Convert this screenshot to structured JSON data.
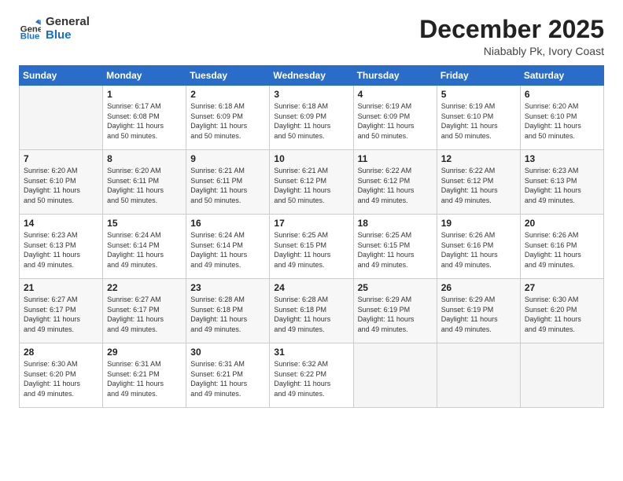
{
  "logo": {
    "general": "General",
    "blue": "Blue"
  },
  "title": "December 2025",
  "location": "Niabably Pk, Ivory Coast",
  "days_of_week": [
    "Sunday",
    "Monday",
    "Tuesday",
    "Wednesday",
    "Thursday",
    "Friday",
    "Saturday"
  ],
  "weeks": [
    [
      {
        "day": "",
        "info": ""
      },
      {
        "day": "1",
        "info": "Sunrise: 6:17 AM\nSunset: 6:08 PM\nDaylight: 11 hours\nand 50 minutes."
      },
      {
        "day": "2",
        "info": "Sunrise: 6:18 AM\nSunset: 6:09 PM\nDaylight: 11 hours\nand 50 minutes."
      },
      {
        "day": "3",
        "info": "Sunrise: 6:18 AM\nSunset: 6:09 PM\nDaylight: 11 hours\nand 50 minutes."
      },
      {
        "day": "4",
        "info": "Sunrise: 6:19 AM\nSunset: 6:09 PM\nDaylight: 11 hours\nand 50 minutes."
      },
      {
        "day": "5",
        "info": "Sunrise: 6:19 AM\nSunset: 6:10 PM\nDaylight: 11 hours\nand 50 minutes."
      },
      {
        "day": "6",
        "info": "Sunrise: 6:20 AM\nSunset: 6:10 PM\nDaylight: 11 hours\nand 50 minutes."
      }
    ],
    [
      {
        "day": "7",
        "info": "Sunrise: 6:20 AM\nSunset: 6:10 PM\nDaylight: 11 hours\nand 50 minutes."
      },
      {
        "day": "8",
        "info": "Sunrise: 6:20 AM\nSunset: 6:11 PM\nDaylight: 11 hours\nand 50 minutes."
      },
      {
        "day": "9",
        "info": "Sunrise: 6:21 AM\nSunset: 6:11 PM\nDaylight: 11 hours\nand 50 minutes."
      },
      {
        "day": "10",
        "info": "Sunrise: 6:21 AM\nSunset: 6:12 PM\nDaylight: 11 hours\nand 50 minutes."
      },
      {
        "day": "11",
        "info": "Sunrise: 6:22 AM\nSunset: 6:12 PM\nDaylight: 11 hours\nand 49 minutes."
      },
      {
        "day": "12",
        "info": "Sunrise: 6:22 AM\nSunset: 6:12 PM\nDaylight: 11 hours\nand 49 minutes."
      },
      {
        "day": "13",
        "info": "Sunrise: 6:23 AM\nSunset: 6:13 PM\nDaylight: 11 hours\nand 49 minutes."
      }
    ],
    [
      {
        "day": "14",
        "info": "Sunrise: 6:23 AM\nSunset: 6:13 PM\nDaylight: 11 hours\nand 49 minutes."
      },
      {
        "day": "15",
        "info": "Sunrise: 6:24 AM\nSunset: 6:14 PM\nDaylight: 11 hours\nand 49 minutes."
      },
      {
        "day": "16",
        "info": "Sunrise: 6:24 AM\nSunset: 6:14 PM\nDaylight: 11 hours\nand 49 minutes."
      },
      {
        "day": "17",
        "info": "Sunrise: 6:25 AM\nSunset: 6:15 PM\nDaylight: 11 hours\nand 49 minutes."
      },
      {
        "day": "18",
        "info": "Sunrise: 6:25 AM\nSunset: 6:15 PM\nDaylight: 11 hours\nand 49 minutes."
      },
      {
        "day": "19",
        "info": "Sunrise: 6:26 AM\nSunset: 6:16 PM\nDaylight: 11 hours\nand 49 minutes."
      },
      {
        "day": "20",
        "info": "Sunrise: 6:26 AM\nSunset: 6:16 PM\nDaylight: 11 hours\nand 49 minutes."
      }
    ],
    [
      {
        "day": "21",
        "info": "Sunrise: 6:27 AM\nSunset: 6:17 PM\nDaylight: 11 hours\nand 49 minutes."
      },
      {
        "day": "22",
        "info": "Sunrise: 6:27 AM\nSunset: 6:17 PM\nDaylight: 11 hours\nand 49 minutes."
      },
      {
        "day": "23",
        "info": "Sunrise: 6:28 AM\nSunset: 6:18 PM\nDaylight: 11 hours\nand 49 minutes."
      },
      {
        "day": "24",
        "info": "Sunrise: 6:28 AM\nSunset: 6:18 PM\nDaylight: 11 hours\nand 49 minutes."
      },
      {
        "day": "25",
        "info": "Sunrise: 6:29 AM\nSunset: 6:19 PM\nDaylight: 11 hours\nand 49 minutes."
      },
      {
        "day": "26",
        "info": "Sunrise: 6:29 AM\nSunset: 6:19 PM\nDaylight: 11 hours\nand 49 minutes."
      },
      {
        "day": "27",
        "info": "Sunrise: 6:30 AM\nSunset: 6:20 PM\nDaylight: 11 hours\nand 49 minutes."
      }
    ],
    [
      {
        "day": "28",
        "info": "Sunrise: 6:30 AM\nSunset: 6:20 PM\nDaylight: 11 hours\nand 49 minutes."
      },
      {
        "day": "29",
        "info": "Sunrise: 6:31 AM\nSunset: 6:21 PM\nDaylight: 11 hours\nand 49 minutes."
      },
      {
        "day": "30",
        "info": "Sunrise: 6:31 AM\nSunset: 6:21 PM\nDaylight: 11 hours\nand 49 minutes."
      },
      {
        "day": "31",
        "info": "Sunrise: 6:32 AM\nSunset: 6:22 PM\nDaylight: 11 hours\nand 49 minutes."
      },
      {
        "day": "",
        "info": ""
      },
      {
        "day": "",
        "info": ""
      },
      {
        "day": "",
        "info": ""
      }
    ]
  ]
}
